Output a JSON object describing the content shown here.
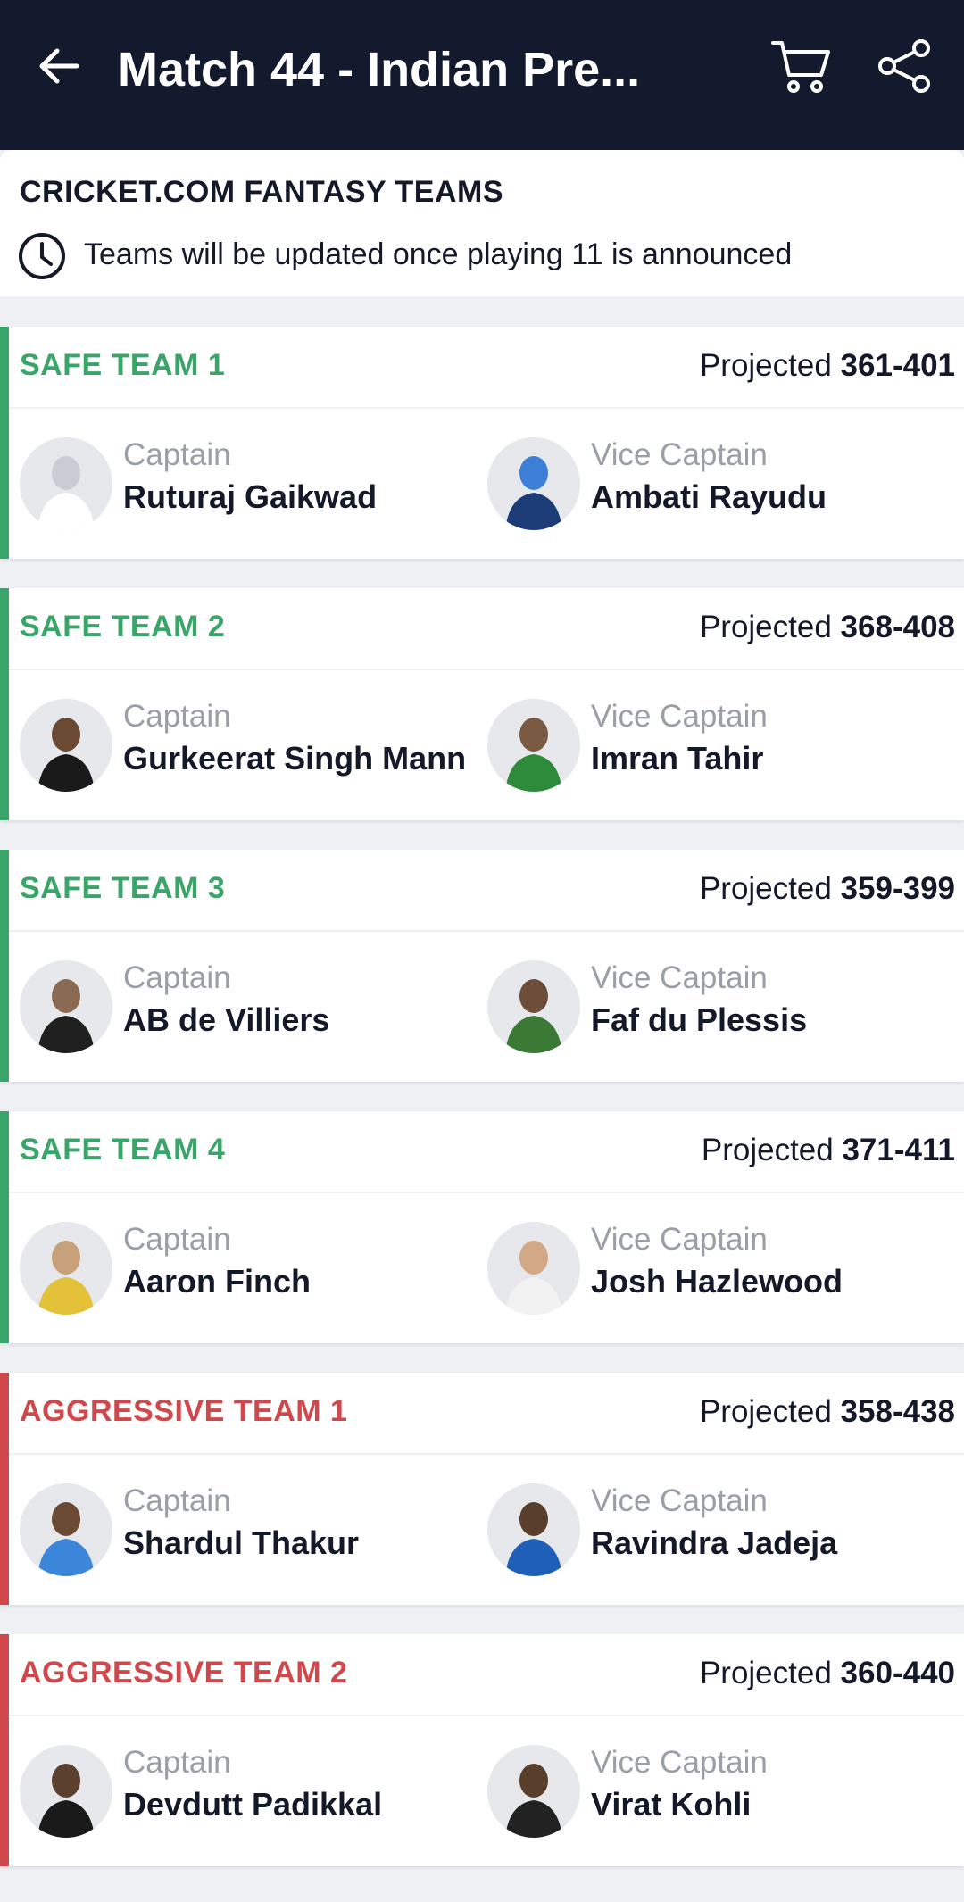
{
  "header": {
    "title": "Match 44 - Indian Pre...",
    "back_icon": "arrow-left-icon",
    "cart_icon": "cart-icon",
    "share_icon": "share-icon"
  },
  "info": {
    "heading": "CRICKET.COM FANTASY TEAMS",
    "note": "Teams will be updated once playing 11 is announced",
    "clock_icon": "clock-icon"
  },
  "colors": {
    "safe": "#3aa569",
    "aggressive": "#d0484b",
    "appbar": "#141a2e"
  },
  "labels": {
    "projected": "Projected",
    "captain": "Captain",
    "vice_captain": "Vice Captain"
  },
  "teams": [
    {
      "name": "SAFE TEAM 1",
      "type": "safe",
      "projected": "361-401",
      "captain": "Ruturaj Gaikwad",
      "vice_captain": "Ambati Rayudu"
    },
    {
      "name": "SAFE TEAM 2",
      "type": "safe",
      "projected": "368-408",
      "captain": "Gurkeerat Singh Mann",
      "vice_captain": "Imran Tahir"
    },
    {
      "name": "SAFE TEAM 3",
      "type": "safe",
      "projected": "359-399",
      "captain": "AB de Villiers",
      "vice_captain": "Faf du Plessis"
    },
    {
      "name": "SAFE TEAM 4",
      "type": "safe",
      "projected": "371-411",
      "captain": "Aaron Finch",
      "vice_captain": "Josh Hazlewood"
    },
    {
      "name": "AGGRESSIVE TEAM 1",
      "type": "aggressive",
      "projected": "358-438",
      "captain": "Shardul Thakur",
      "vice_captain": "Ravindra Jadeja"
    },
    {
      "name": "AGGRESSIVE TEAM 2",
      "type": "aggressive",
      "projected": "360-440",
      "captain": "Devdutt Padikkal",
      "vice_captain": "Virat Kohli"
    }
  ]
}
